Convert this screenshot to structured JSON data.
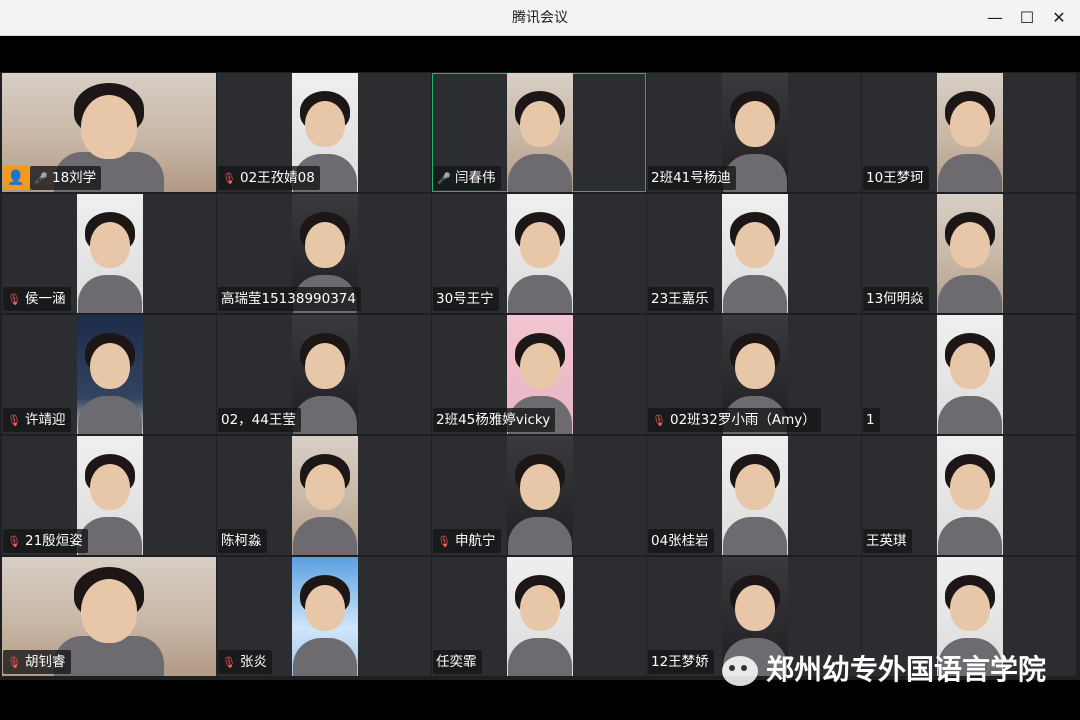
{
  "window": {
    "title": "腾讯会议",
    "controls": {
      "minimize": "—",
      "maximize": "☐",
      "close": "✕"
    }
  },
  "participants": [
    {
      "name": "18刘学",
      "mic": "on",
      "host": true,
      "video": "wide"
    },
    {
      "name": "02王孜婧08",
      "mic": "muted",
      "video": "light"
    },
    {
      "name": "闫春伟",
      "mic": "on",
      "active_speaker": true,
      "video": "normal"
    },
    {
      "name": "2班41号杨迪",
      "mic": "none",
      "video": "dark"
    },
    {
      "name": "10王梦珂",
      "mic": "none",
      "video": "normal"
    },
    {
      "name": "侯一涵",
      "mic": "muted",
      "video": "light"
    },
    {
      "name": "高瑞莹15138990374",
      "mic": "none",
      "video": "dark"
    },
    {
      "name": "30号王宁",
      "mic": "none",
      "video": "light"
    },
    {
      "name": "23王嘉乐",
      "mic": "none",
      "video": "light"
    },
    {
      "name": "13何明焱",
      "mic": "none",
      "video": "normal"
    },
    {
      "name": "许靖迎",
      "mic": "muted",
      "video": "night"
    },
    {
      "name": "02，44王莹",
      "mic": "none",
      "video": "dark"
    },
    {
      "name": "2班45杨雅婷vicky",
      "mic": "none",
      "video": "pink"
    },
    {
      "name": "02班32罗小雨（Amy）",
      "mic": "muted",
      "video": "dark"
    },
    {
      "name": "1",
      "mic": "none",
      "video": "light"
    },
    {
      "name": "21殷烜姿",
      "mic": "muted",
      "video": "light"
    },
    {
      "name": "陈柯淼",
      "mic": "none",
      "video": "normal"
    },
    {
      "name": "申航宁",
      "mic": "muted",
      "video": "dark"
    },
    {
      "name": "04张桂岩",
      "mic": "none",
      "video": "light"
    },
    {
      "name": "王英琪",
      "mic": "none",
      "video": "light"
    },
    {
      "name": "胡钊睿",
      "mic": "muted",
      "video": "wide"
    },
    {
      "name": "张炎",
      "mic": "muted",
      "video": "sky"
    },
    {
      "name": "任奕霏",
      "mic": "none",
      "video": "light"
    },
    {
      "name": "12王梦娇",
      "mic": "none",
      "video": "dark"
    },
    {
      "name": "",
      "mic": "none",
      "video": "light"
    }
  ],
  "icons": {
    "mic_on": "microphone-icon",
    "mic_muted": "microphone-muted-icon",
    "host": "host-person-icon"
  },
  "colors": {
    "active_border": "#1fb36b",
    "host_badge": "#f39a1d",
    "muted": "#ff5a5f"
  },
  "watermark": {
    "text": "郑州幼专外国语言学院"
  }
}
